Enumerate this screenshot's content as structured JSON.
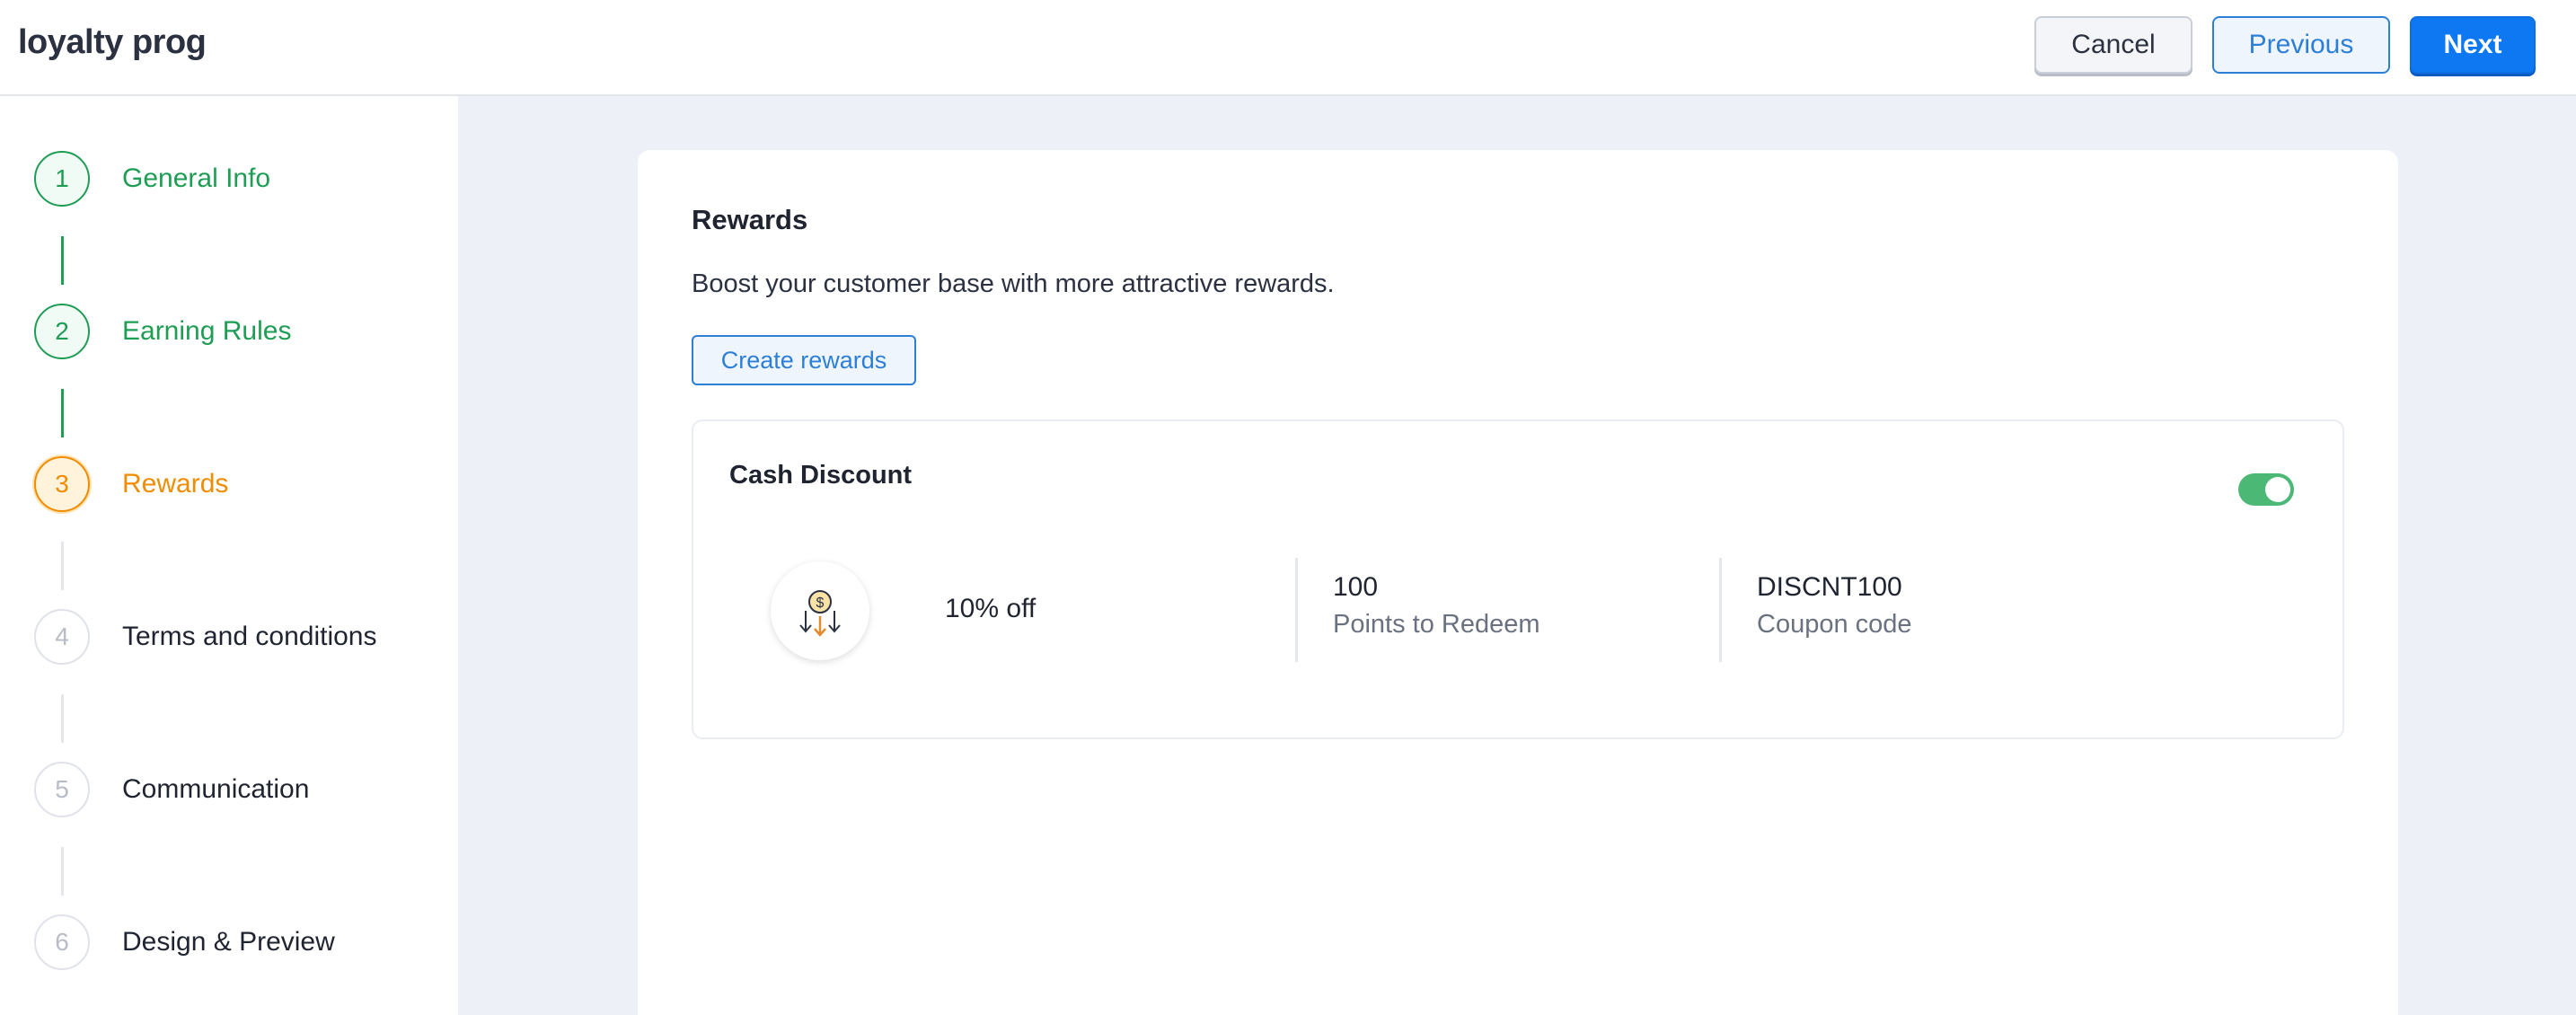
{
  "header": {
    "title": "loyalty prog",
    "cancel_label": "Cancel",
    "previous_label": "Previous",
    "next_label": "Next"
  },
  "steps": [
    {
      "number": "1",
      "label": "General Info",
      "state": "done"
    },
    {
      "number": "2",
      "label": "Earning Rules",
      "state": "done"
    },
    {
      "number": "3",
      "label": "Rewards",
      "state": "active"
    },
    {
      "number": "4",
      "label": "Terms and conditions",
      "state": "pending"
    },
    {
      "number": "5",
      "label": "Communication",
      "state": "pending"
    },
    {
      "number": "6",
      "label": "Design & Preview",
      "state": "pending"
    }
  ],
  "main": {
    "section_title": "Rewards",
    "section_description": "Boost your customer base with more attractive rewards.",
    "create_button_label": "Create rewards",
    "reward": {
      "name": "Cash Discount",
      "enabled": true,
      "icon": "cash-discount-icon",
      "offer": "10% off",
      "points_value": "100",
      "points_label": "Points to Redeem",
      "coupon_value": "DISCNT100",
      "coupon_label": "Coupon code"
    }
  },
  "colors": {
    "done": "#1f9d55",
    "active": "#f08c00",
    "primary": "#0d78f2",
    "toggle_on": "#4cb876"
  }
}
